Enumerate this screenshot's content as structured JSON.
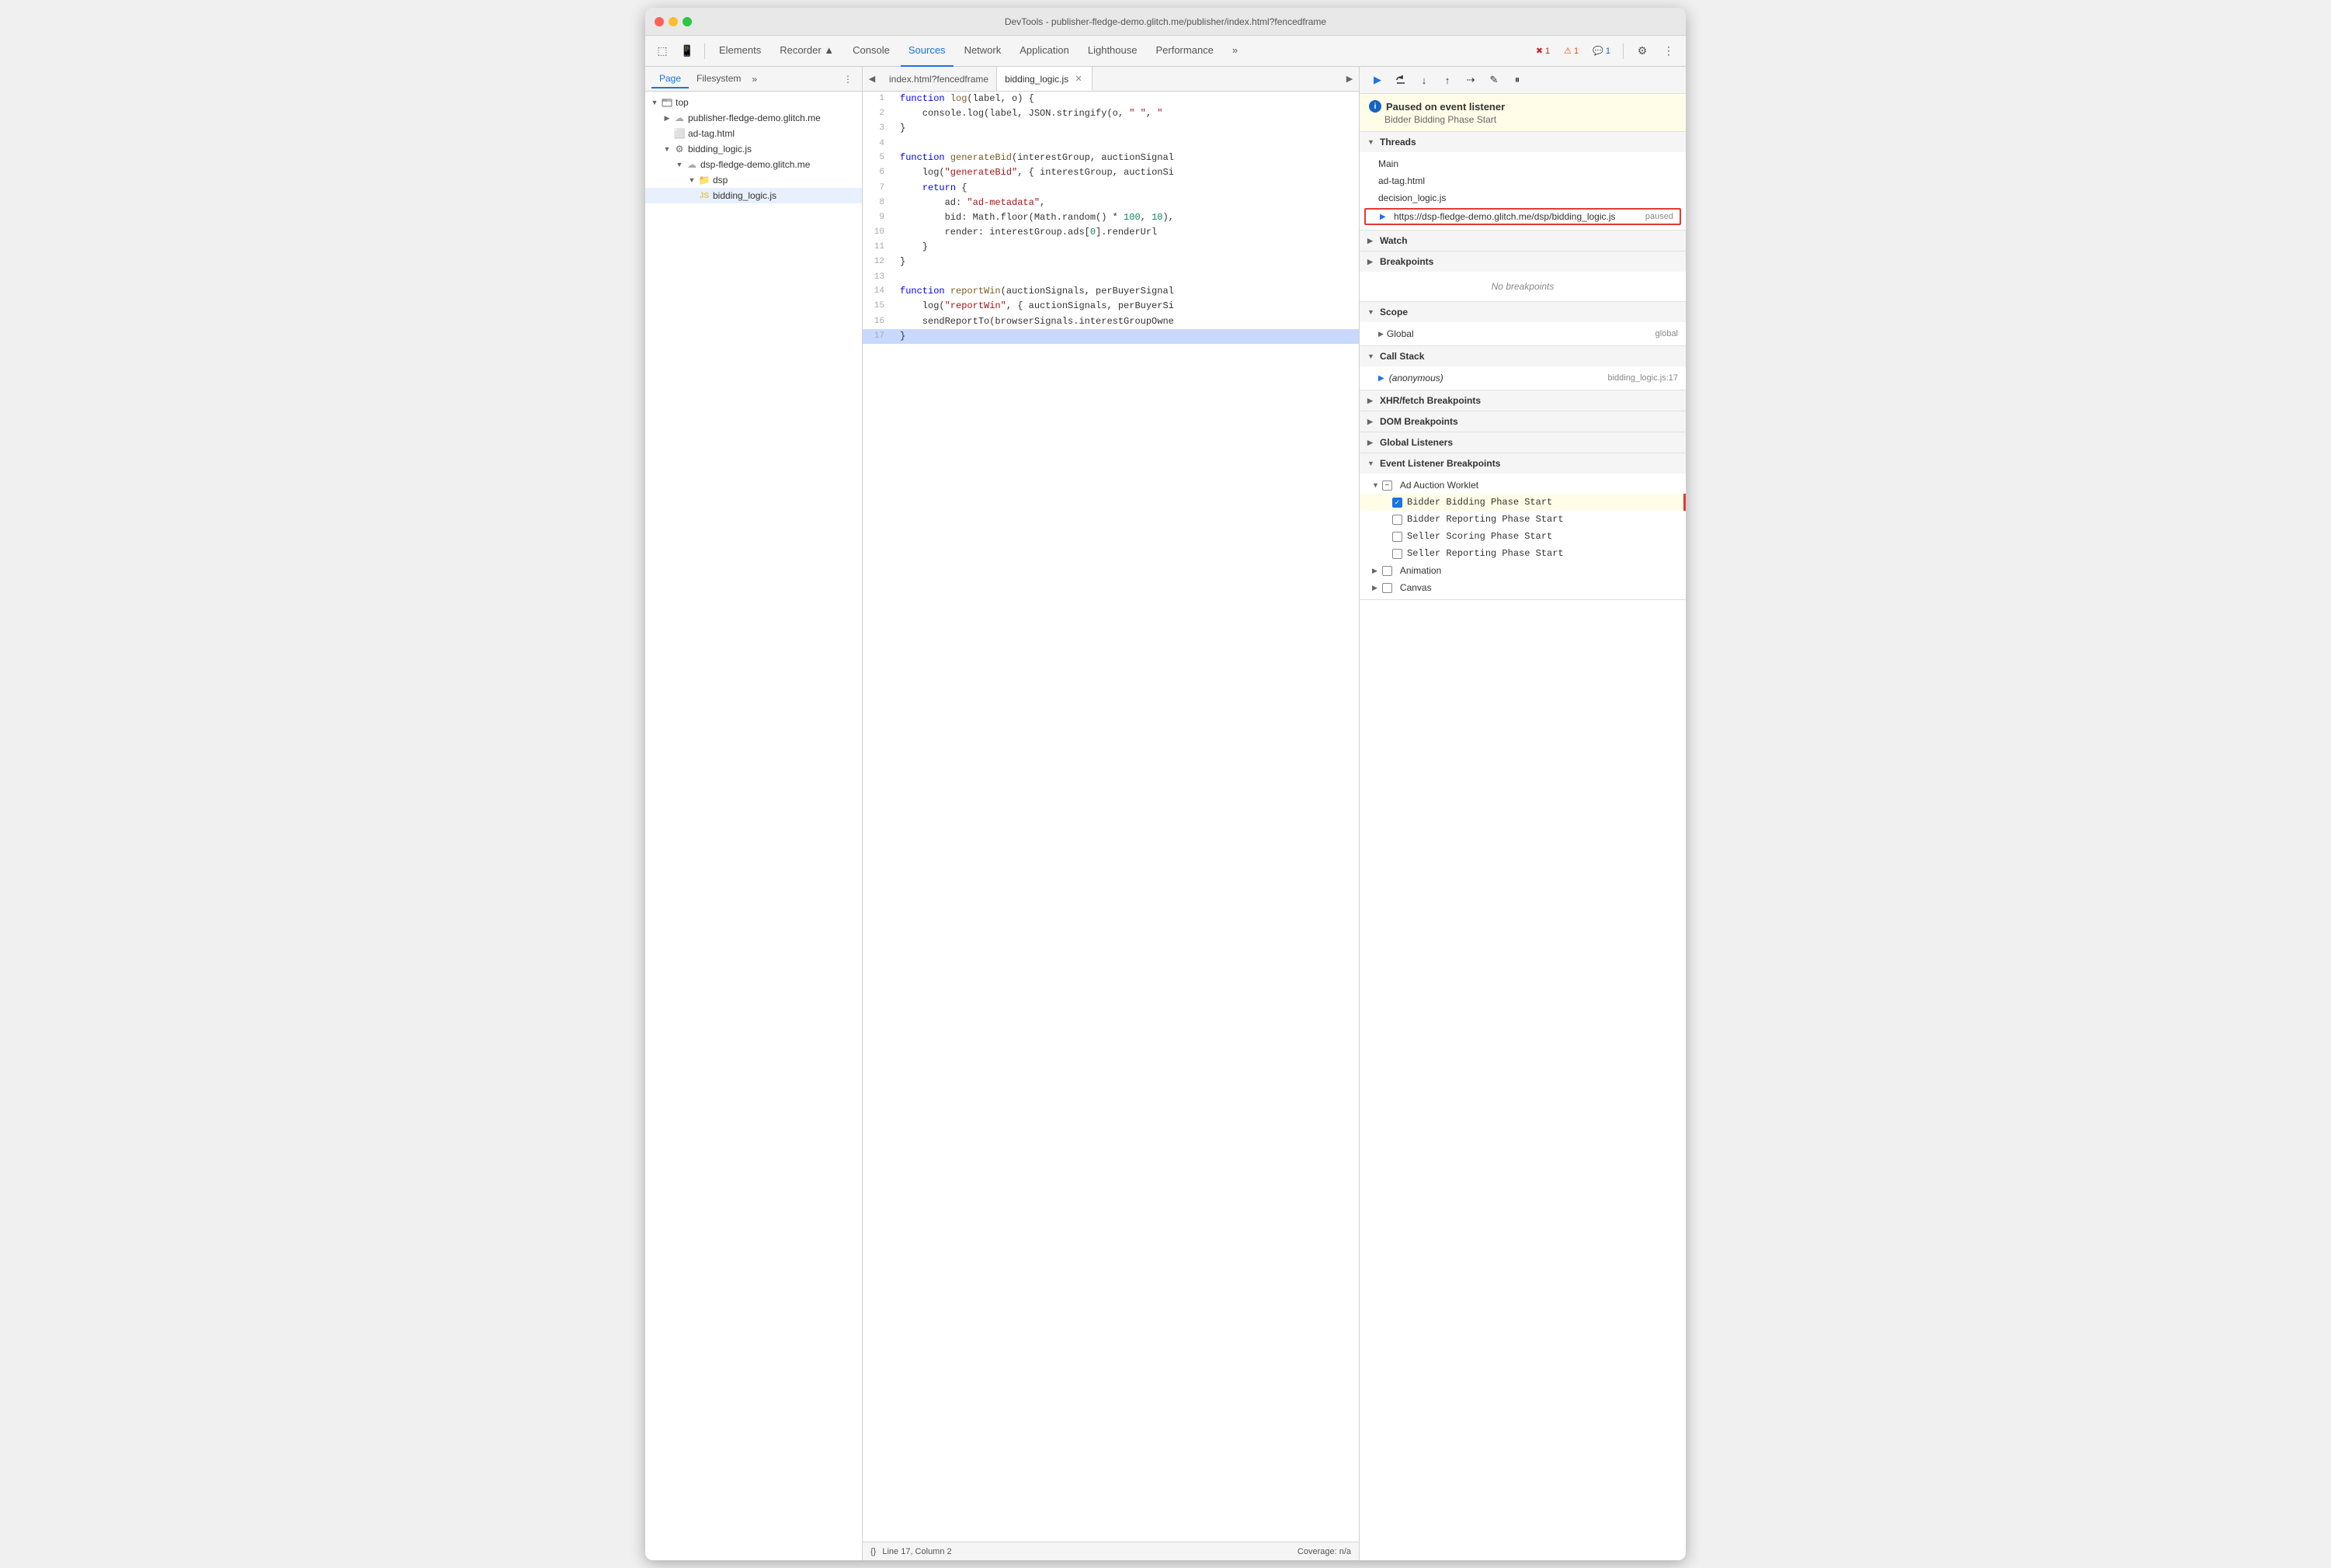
{
  "window": {
    "title": "DevTools - publisher-fledge-demo.glitch.me/publisher/index.html?fencedframe"
  },
  "toolbar": {
    "tabs": [
      {
        "label": "Elements",
        "active": false
      },
      {
        "label": "Recorder ▲",
        "active": false
      },
      {
        "label": "Console",
        "active": false
      },
      {
        "label": "Sources",
        "active": true
      },
      {
        "label": "Network",
        "active": false
      },
      {
        "label": "Application",
        "active": false
      },
      {
        "label": "Lighthouse",
        "active": false
      },
      {
        "label": "Performance",
        "active": false
      }
    ],
    "more_label": "»",
    "badges": {
      "error": "1",
      "warning": "1",
      "info": "1"
    },
    "icons": {
      "cursor": "⬚",
      "mobile": "⧉",
      "settings": "⚙",
      "more": "⋮"
    }
  },
  "left_panel": {
    "tabs": [
      "Page",
      "Filesystem"
    ],
    "active_tab": "Page",
    "more": "»",
    "tree": [
      {
        "id": "top",
        "label": "top",
        "indent": 0,
        "expanded": true,
        "type": "root",
        "icon": "folder-outline"
      },
      {
        "id": "publisher",
        "label": "publisher-fledge-demo.glitch.me",
        "indent": 1,
        "expanded": false,
        "type": "domain",
        "icon": "cloud"
      },
      {
        "id": "ad-tag",
        "label": "ad-tag.html",
        "indent": 1,
        "expanded": false,
        "type": "html",
        "icon": "file"
      },
      {
        "id": "bidding-folder",
        "label": "bidding_logic.js",
        "indent": 1,
        "expanded": true,
        "type": "js",
        "icon": "gear"
      },
      {
        "id": "dsp-domain",
        "label": "dsp-fledge-demo.glitch.me",
        "indent": 2,
        "expanded": true,
        "type": "domain",
        "icon": "cloud"
      },
      {
        "id": "dsp-folder",
        "label": "dsp",
        "indent": 3,
        "expanded": true,
        "type": "folder",
        "icon": "folder"
      },
      {
        "id": "bidding-js",
        "label": "bidding_logic.js",
        "indent": 4,
        "expanded": false,
        "type": "js-file",
        "icon": "js",
        "selected": true
      }
    ]
  },
  "editor": {
    "tabs": [
      {
        "label": "index.html?fencedframe",
        "active": false,
        "closeable": false
      },
      {
        "label": "bidding_logic.js",
        "active": true,
        "closeable": true
      }
    ],
    "nav_left": "◀",
    "nav_right": "▶",
    "lines": [
      {
        "num": 1,
        "content": "function log(label, o) {",
        "highlighted": false
      },
      {
        "num": 2,
        "content": "    console.log(label, JSON.stringify(o, \" \", \"",
        "highlighted": false
      },
      {
        "num": 3,
        "content": "}",
        "highlighted": false
      },
      {
        "num": 4,
        "content": "",
        "highlighted": false
      },
      {
        "num": 5,
        "content": "function generateBid(interestGroup, auctionSignal",
        "highlighted": false
      },
      {
        "num": 6,
        "content": "    log(\"generateBid\", { interestGroup, auctionSi",
        "highlighted": false
      },
      {
        "num": 7,
        "content": "    return {",
        "highlighted": false
      },
      {
        "num": 8,
        "content": "        ad: \"ad-metadata\",",
        "highlighted": false
      },
      {
        "num": 9,
        "content": "        bid: Math.floor(Math.random() * 100, 10),",
        "highlighted": false
      },
      {
        "num": 10,
        "content": "        render: interestGroup.ads[0].renderUrl",
        "highlighted": false
      },
      {
        "num": 11,
        "content": "    }",
        "highlighted": false
      },
      {
        "num": 12,
        "content": "}",
        "highlighted": false
      },
      {
        "num": 13,
        "content": "",
        "highlighted": false
      },
      {
        "num": 14,
        "content": "function reportWin(auctionSignals, perBuyerSignal",
        "highlighted": false
      },
      {
        "num": 15,
        "content": "    log(\"reportWin\", { auctionSignals, perBuyerSi",
        "highlighted": false
      },
      {
        "num": 16,
        "content": "    sendReportTo(browserSignals.interestGroupOwne",
        "highlighted": false
      },
      {
        "num": 17,
        "content": "}",
        "highlighted": true
      }
    ],
    "status": {
      "format": "{}",
      "position": "Line 17, Column 2",
      "coverage": "Coverage: n/a"
    }
  },
  "debugger": {
    "toolbar_buttons": [
      {
        "icon": "▶",
        "label": "resume",
        "blue": true
      },
      {
        "icon": "↺",
        "label": "step-over"
      },
      {
        "icon": "↓",
        "label": "step-into"
      },
      {
        "icon": "↑",
        "label": "step-out"
      },
      {
        "icon": "⇢",
        "label": "step"
      },
      {
        "icon": "✎",
        "label": "edit"
      },
      {
        "icon": "⏸",
        "label": "deactivate"
      }
    ],
    "paused": {
      "title": "Paused on event listener",
      "subtitle": "Bidder Bidding Phase Start"
    },
    "threads": {
      "label": "Threads",
      "items": [
        {
          "label": "Main",
          "selected": false
        },
        {
          "label": "ad-tag.html",
          "selected": false
        },
        {
          "label": "decision_logic.js",
          "selected": false
        },
        {
          "label": "https://dsp-fledge-demo.glitch.me/dsp/bidding_logic.js",
          "status": "paused",
          "selected": true
        }
      ]
    },
    "watch": {
      "label": "Watch"
    },
    "breakpoints": {
      "label": "Breakpoints",
      "empty": "No breakpoints"
    },
    "scope": {
      "label": "Scope",
      "items": [
        {
          "label": "Global",
          "value": "global",
          "expandable": true
        }
      ]
    },
    "call_stack": {
      "label": "Call Stack",
      "items": [
        {
          "label": "(anonymous)",
          "value": "bidding_logic.js:17"
        }
      ]
    },
    "xhr_breakpoints": {
      "label": "XHR/fetch Breakpoints"
    },
    "dom_breakpoints": {
      "label": "DOM Breakpoints"
    },
    "global_listeners": {
      "label": "Global Listeners"
    },
    "event_listener_breakpoints": {
      "label": "Event Listener Breakpoints",
      "sub_sections": [
        {
          "label": "Ad Auction Worklet",
          "expanded": true,
          "items": [
            {
              "label": "Bidder Bidding Phase Start",
              "checked": true,
              "highlighted": true
            },
            {
              "label": "Bidder Reporting Phase Start",
              "checked": false
            },
            {
              "label": "Seller Scoring Phase Start",
              "checked": false
            },
            {
              "label": "Seller Reporting Phase Start",
              "checked": false
            }
          ]
        },
        {
          "label": "Animation",
          "expanded": false,
          "items": []
        },
        {
          "label": "Canvas",
          "expanded": false,
          "items": []
        }
      ]
    }
  }
}
